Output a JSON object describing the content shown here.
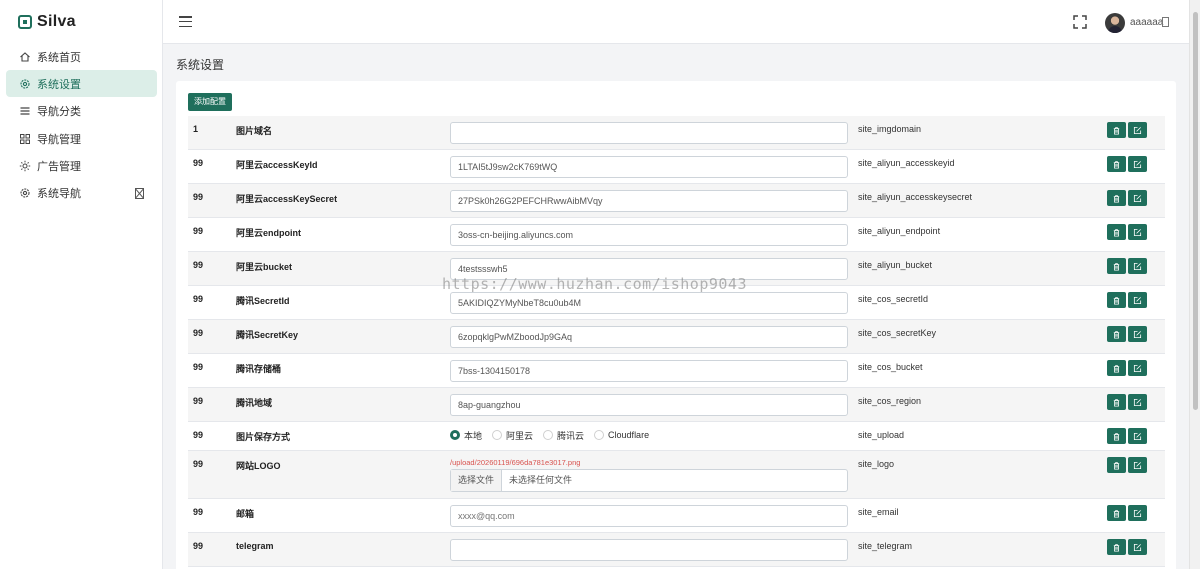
{
  "brand": {
    "name": "Silva"
  },
  "sidebar": {
    "items": [
      {
        "label": "系统首页",
        "icon": "home-icon",
        "active": false
      },
      {
        "label": "系统设置",
        "icon": "gear-icon",
        "active": true
      },
      {
        "label": "导航分类",
        "icon": "list-icon",
        "active": false
      },
      {
        "label": "导航管理",
        "icon": "grid-icon",
        "active": false
      },
      {
        "label": "广告管理",
        "icon": "sun-icon",
        "active": false
      },
      {
        "label": "系统导航",
        "icon": "gear-icon",
        "active": false
      }
    ]
  },
  "header": {
    "username": "aaaaaa"
  },
  "page": {
    "title": "系统设置",
    "add_button": "添加配置"
  },
  "rows": [
    {
      "sort": "1",
      "title": "图片域名",
      "value": "",
      "key": "site_imgdomain"
    },
    {
      "sort": "99",
      "title": "阿里云accessKeyId",
      "value": "1LTAI5tJ9sw2cK769tWQ",
      "key": "site_aliyun_accesskeyid"
    },
    {
      "sort": "99",
      "title": "阿里云accessKeySecret",
      "value": "27PSk0h26G2PEFCHRwwAibMVqy",
      "key": "site_aliyun_accesskeysecret"
    },
    {
      "sort": "99",
      "title": "阿里云endpoint",
      "value": "3oss-cn-beijing.aliyuncs.com",
      "key": "site_aliyun_endpoint"
    },
    {
      "sort": "99",
      "title": "阿里云bucket",
      "value": "4testssswh5",
      "key": "site_aliyun_bucket"
    },
    {
      "sort": "99",
      "title": "腾讯SecretId",
      "value": "5AKIDIQZYMyNbeT8cu0ub4M",
      "key": "site_cos_secretId"
    },
    {
      "sort": "99",
      "title": "腾讯SecretKey",
      "value": "6zopqklgPwMZboodJp9GAq",
      "key": "site_cos_secretKey"
    },
    {
      "sort": "99",
      "title": "腾讯存储桶",
      "value": "7bss-1304150178",
      "key": "site_cos_bucket"
    },
    {
      "sort": "99",
      "title": "腾讯地域",
      "value": "8ap-guangzhou",
      "key": "site_cos_region"
    },
    {
      "sort": "99",
      "title": "图片保存方式",
      "key": "site_upload",
      "options": [
        {
          "label": "本地",
          "checked": true
        },
        {
          "label": "阿里云",
          "checked": false
        },
        {
          "label": "腾讯云",
          "checked": false
        },
        {
          "label": "Cloudflare",
          "checked": false
        }
      ]
    },
    {
      "sort": "99",
      "title": "网站LOGO",
      "key": "site_logo",
      "path": "/upload/20260119/696da781e3017.png",
      "file_button": "选择文件",
      "file_status": "未选择任何文件"
    },
    {
      "sort": "99",
      "title": "邮箱",
      "value": "",
      "placeholder": "xxxx@qq.com",
      "key": "site_email"
    },
    {
      "sort": "99",
      "title": "telegram",
      "value": "",
      "key": "site_telegram"
    }
  ],
  "watermark": "https://www.huzhan.com/ishop9043"
}
